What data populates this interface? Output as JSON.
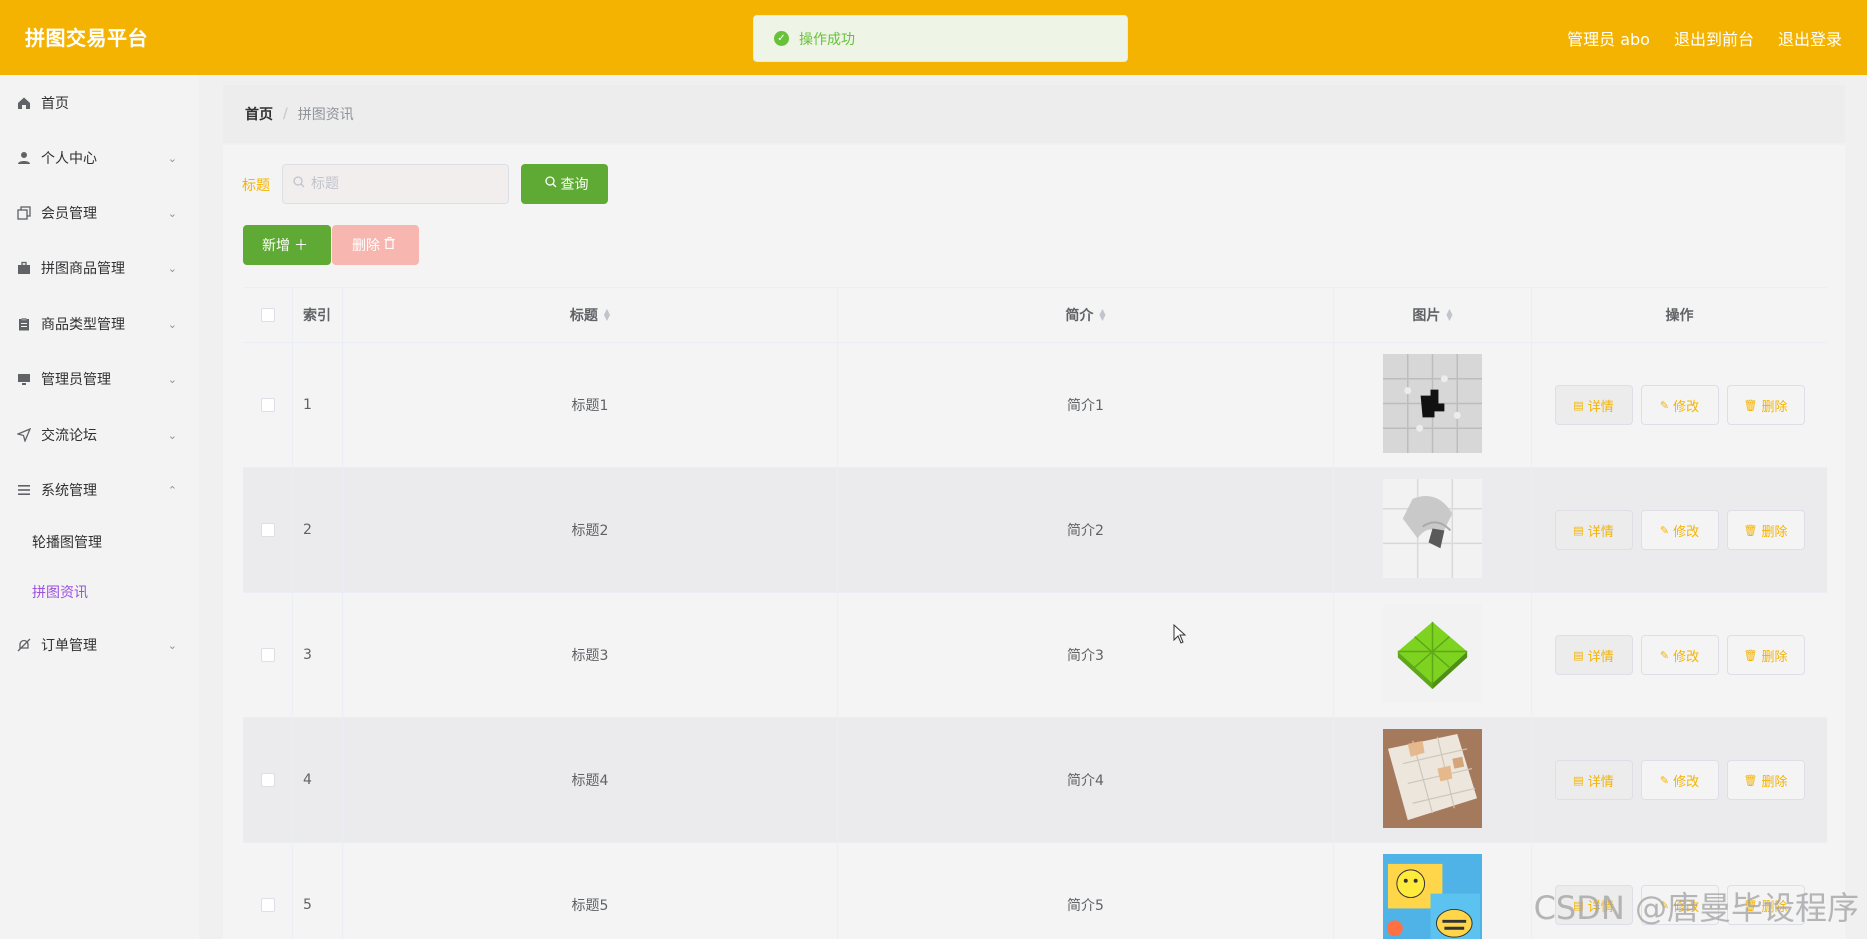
{
  "header": {
    "brand": "拼图交易平台",
    "toast": "操作成功",
    "admin_label": "管理员 abo",
    "to_front": "退出到前台",
    "logout": "退出登录",
    "accent_color": "#f5b301"
  },
  "sidebar": {
    "items": [
      {
        "label": "首页",
        "icon": "home-icon"
      },
      {
        "label": "个人中心",
        "icon": "user-icon"
      },
      {
        "label": "会员管理",
        "icon": "copy-icon"
      },
      {
        "label": "拼图商品管理",
        "icon": "suitcase-icon"
      },
      {
        "label": "商品类型管理",
        "icon": "clipboard-icon"
      },
      {
        "label": "管理员管理",
        "icon": "monitor-icon"
      },
      {
        "label": "交流论坛",
        "icon": "send-icon"
      },
      {
        "label": "系统管理",
        "icon": "menu-icon"
      },
      {
        "label": "订单管理",
        "icon": "bell-off-icon"
      }
    ],
    "sub_items": [
      {
        "label": "轮播图管理",
        "active": false
      },
      {
        "label": "拼图资讯",
        "active": true
      }
    ]
  },
  "breadcrumb": {
    "home": "首页",
    "separator": "/",
    "current": "拼图资讯"
  },
  "search": {
    "label": "标题",
    "placeholder": "标题",
    "query_button": "查询"
  },
  "actions": {
    "add": "新增",
    "delete": "删除"
  },
  "table": {
    "headers": {
      "index": "索引",
      "title": "标题",
      "desc": "简介",
      "image": "图片",
      "ops": "操作"
    },
    "op_labels": {
      "detail": "详情",
      "edit": "修改",
      "delete": "删除"
    },
    "rows": [
      {
        "index": "1",
        "title": "标题1",
        "desc": "简介1",
        "image": "gray-puzzle-missing-black-piece"
      },
      {
        "index": "2",
        "title": "标题2",
        "desc": "简介2",
        "image": "white-puzzle-curl"
      },
      {
        "index": "3",
        "title": "标题3",
        "desc": "简介3",
        "image": "green-puzzle-mat"
      },
      {
        "index": "4",
        "title": "标题4",
        "desc": "简介4",
        "image": "beige-puzzle-on-wood"
      },
      {
        "index": "5",
        "title": "标题5",
        "desc": "简介5",
        "image": "cartoon-bee-puzzle-box"
      }
    ]
  },
  "watermark": "CSDN @唐曼毕设程序"
}
